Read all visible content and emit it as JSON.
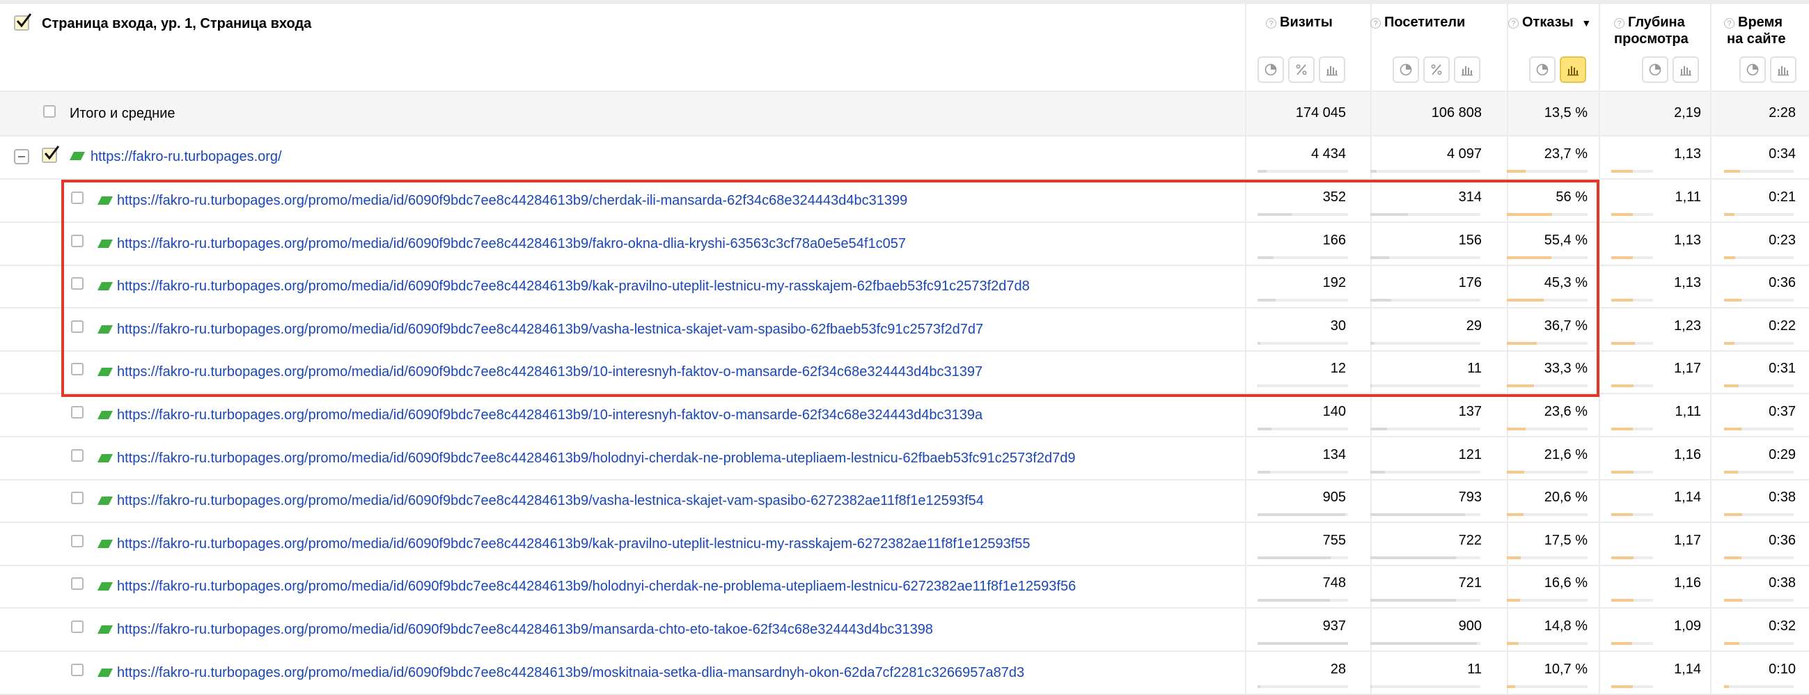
{
  "header": {
    "dimension_title": "Страница входа, ур. 1, Страница входа",
    "columns": [
      {
        "label": "Визиты",
        "line2": ""
      },
      {
        "label": "Посетители",
        "line2": ""
      },
      {
        "label": "Отказы",
        "line2": "",
        "sort": "▼"
      },
      {
        "label": "Глубина",
        "line2": "просмотра"
      },
      {
        "label": "Время",
        "line2": "на сайте"
      }
    ],
    "help_glyph": "?"
  },
  "totals": {
    "label": "Итого и средние",
    "visits": "174 045",
    "visitors": "106 808",
    "bounce": "13,5 %",
    "depth": "2,19",
    "time": "2:28"
  },
  "group": {
    "url": "https://fakro-ru.turbopages.org/",
    "visits": "4 434",
    "visitors": "4 097",
    "bounce": "23,7 %",
    "depth": "1,13",
    "time": "0:34"
  },
  "rows": [
    {
      "url": "https://fakro-ru.turbopages.org/promo/media/id/6090f9bdc7ee8c44284613b9/cherdak-ili-mansarda-62f34c68e324443d4bc31399",
      "visits": "352",
      "visitors": "314",
      "bounce": "56 %",
      "depth": "1,11",
      "time": "0:21",
      "visits_frac": 0.38,
      "visitors_frac": 0.34,
      "bounce_frac": 0.56,
      "depth_frac": 0.51,
      "time_frac": 0.15
    },
    {
      "url": "https://fakro-ru.turbopages.org/promo/media/id/6090f9bdc7ee8c44284613b9/fakro-okna-dlia-kryshi-63563c3cf78a0e5e54f1c057",
      "visits": "166",
      "visitors": "156",
      "bounce": "55,4 %",
      "depth": "1,13",
      "time": "0:23",
      "visits_frac": 0.18,
      "visitors_frac": 0.17,
      "bounce_frac": 0.554,
      "depth_frac": 0.52,
      "time_frac": 0.16
    },
    {
      "url": "https://fakro-ru.turbopages.org/promo/media/id/6090f9bdc7ee8c44284613b9/kak-pravilno-uteplit-lestnicu-my-rasskajem-62fbaeb53fc91c2573f2d7d8",
      "visits": "192",
      "visitors": "176",
      "bounce": "45,3 %",
      "depth": "1,13",
      "time": "0:36",
      "visits_frac": 0.2,
      "visitors_frac": 0.19,
      "bounce_frac": 0.453,
      "depth_frac": 0.52,
      "time_frac": 0.25
    },
    {
      "url": "https://fakro-ru.turbopages.org/promo/media/id/6090f9bdc7ee8c44284613b9/vasha-lestnica-skajet-vam-spasibo-62fbaeb53fc91c2573f2d7d7",
      "visits": "30",
      "visitors": "29",
      "bounce": "36,7 %",
      "depth": "1,23",
      "time": "0:22",
      "visits_frac": 0.03,
      "visitors_frac": 0.03,
      "bounce_frac": 0.367,
      "depth_frac": 0.56,
      "time_frac": 0.15
    },
    {
      "url": "https://fakro-ru.turbopages.org/promo/media/id/6090f9bdc7ee8c44284613b9/10-interesnyh-faktov-o-mansarde-62f34c68e324443d4bc31397",
      "visits": "12",
      "visitors": "11",
      "bounce": "33,3 %",
      "depth": "1,17",
      "time": "0:31",
      "visits_frac": 0.01,
      "visitors_frac": 0.01,
      "bounce_frac": 0.333,
      "depth_frac": 0.53,
      "time_frac": 0.21
    },
    {
      "url": "https://fakro-ru.turbopages.org/promo/media/id/6090f9bdc7ee8c44284613b9/10-interesnyh-faktov-o-mansarde-62f34c68e324443d4bc3139a",
      "visits": "140",
      "visitors": "137",
      "bounce": "23,6 %",
      "depth": "1,11",
      "time": "0:37",
      "visits_frac": 0.15,
      "visitors_frac": 0.15,
      "bounce_frac": 0.236,
      "depth_frac": 0.51,
      "time_frac": 0.25
    },
    {
      "url": "https://fakro-ru.turbopages.org/promo/media/id/6090f9bdc7ee8c44284613b9/holodnyi-cherdak-ne-problema-utepliaem-lestnicu-62fbaeb53fc91c2573f2d7d9",
      "visits": "134",
      "visitors": "121",
      "bounce": "21,6 %",
      "depth": "1,16",
      "time": "0:29",
      "visits_frac": 0.14,
      "visitors_frac": 0.13,
      "bounce_frac": 0.216,
      "depth_frac": 0.53,
      "time_frac": 0.2
    },
    {
      "url": "https://fakro-ru.turbopages.org/promo/media/id/6090f9bdc7ee8c44284613b9/vasha-lestnica-skajet-vam-spasibo-6272382ae11f8f1e12593f54",
      "visits": "905",
      "visitors": "793",
      "bounce": "20,6 %",
      "depth": "1,14",
      "time": "0:38",
      "visits_frac": 0.97,
      "visitors_frac": 0.86,
      "bounce_frac": 0.206,
      "depth_frac": 0.52,
      "time_frac": 0.26
    },
    {
      "url": "https://fakro-ru.turbopages.org/promo/media/id/6090f9bdc7ee8c44284613b9/kak-pravilno-uteplit-lestnicu-my-rasskajem-6272382ae11f8f1e12593f55",
      "visits": "755",
      "visitors": "722",
      "bounce": "17,5 %",
      "depth": "1,17",
      "time": "0:36",
      "visits_frac": 0.81,
      "visitors_frac": 0.78,
      "bounce_frac": 0.175,
      "depth_frac": 0.53,
      "time_frac": 0.25
    },
    {
      "url": "https://fakro-ru.turbopages.org/promo/media/id/6090f9bdc7ee8c44284613b9/holodnyi-cherdak-ne-problema-utepliaem-lestnicu-6272382ae11f8f1e12593f56",
      "visits": "748",
      "visitors": "721",
      "bounce": "16,6 %",
      "depth": "1,16",
      "time": "0:38",
      "visits_frac": 0.8,
      "visitors_frac": 0.78,
      "bounce_frac": 0.166,
      "depth_frac": 0.53,
      "time_frac": 0.26
    },
    {
      "url": "https://fakro-ru.turbopages.org/promo/media/id/6090f9bdc7ee8c44284613b9/mansarda-chto-eto-takoe-62f34c68e324443d4bc31398",
      "visits": "937",
      "visitors": "900",
      "bounce": "14,8 %",
      "depth": "1,09",
      "time": "0:32",
      "visits_frac": 1.0,
      "visitors_frac": 0.97,
      "bounce_frac": 0.148,
      "depth_frac": 0.5,
      "time_frac": 0.22
    },
    {
      "url": "https://fakro-ru.turbopages.org/promo/media/id/6090f9bdc7ee8c44284613b9/moskitnaia-setka-dlia-mansardnyh-okon-62da7cf2281c3266957a87d3",
      "visits": "28",
      "visitors": "11",
      "bounce": "10,7 %",
      "depth": "1,14",
      "time": "0:10",
      "visits_frac": 0.03,
      "visitors_frac": 0.01,
      "bounce_frac": 0.107,
      "depth_frac": 0.52,
      "time_frac": 0.07
    }
  ],
  "group_fracs": {
    "visits_frac": 0.1,
    "visitors_frac": 0.06,
    "bounce_frac": 0.237,
    "depth_frac": 0.52,
    "time_frac": 0.23
  },
  "colors": {
    "link": "#1a47b8",
    "bounce_bar": "#f5c98e",
    "neutral_bar": "#d9d9d9",
    "highlight": "#e0382a",
    "flag": "#3fae3f"
  },
  "icons": [
    "pie-chart-icon",
    "percent-icon",
    "bar-chart-icon"
  ]
}
